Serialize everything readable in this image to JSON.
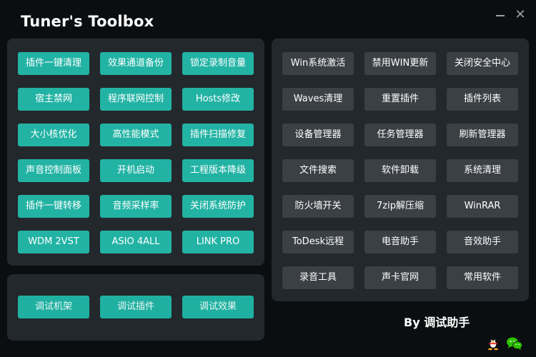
{
  "window": {
    "title": "Tuner's Toolbox",
    "minimize_icon": "minimize-icon",
    "close_glyph": "✕"
  },
  "left_panel": {
    "buttons": [
      [
        "插件一键清理",
        "效果通道备份",
        "锁定录制音量"
      ],
      [
        "宿主禁网",
        "程序联网控制",
        "Hosts修改"
      ],
      [
        "大小核优化",
        "高性能模式",
        "插件扫描修复"
      ],
      [
        "声音控制面板",
        "开机启动",
        "工程版本降级"
      ],
      [
        "插件一键转移",
        "音频采样率",
        "关闭系统防护"
      ],
      [
        "WDM 2VST",
        "ASIO 4ALL",
        "LINK PRO"
      ]
    ]
  },
  "bottom_panel": {
    "buttons": [
      "调试机架",
      "调试插件",
      "调试效果"
    ]
  },
  "right_panel": {
    "buttons": [
      [
        "Win系统激活",
        "禁用WIN更新",
        "关闭安全中心"
      ],
      [
        "Waves清理",
        "重置插件",
        "插件列表"
      ],
      [
        "设备管理器",
        "任务管理器",
        "刷新管理器"
      ],
      [
        "文件搜索",
        "软件卸载",
        "系统清理"
      ],
      [
        "防火墙开关",
        "7zip解压缩",
        "WinRAR"
      ],
      [
        "ToDesk远程",
        "电音助手",
        "音效助手"
      ],
      [
        "录音工具",
        "声卡官网",
        "常用软件"
      ]
    ]
  },
  "footer": {
    "by_label": "By 调试助手",
    "icons": [
      "qq-icon",
      "wechat-icon"
    ]
  },
  "colors": {
    "background": "#0b0e10",
    "panel": "#23282c",
    "teal_button": "#22b3a4",
    "gray_button": "#3b4045"
  }
}
